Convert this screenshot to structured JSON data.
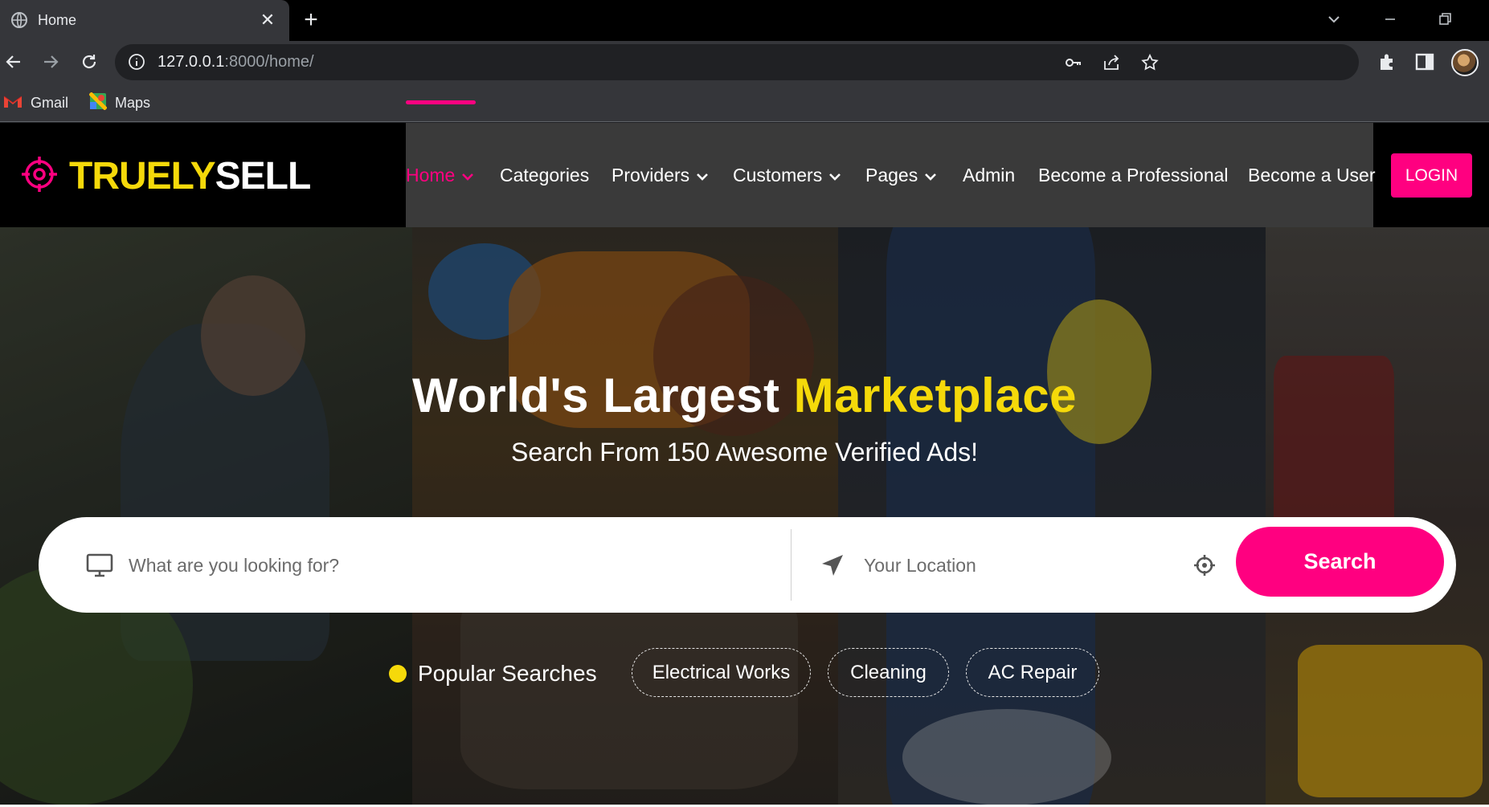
{
  "browser": {
    "tab_title": "Home",
    "url_host": "127.0.0.1",
    "url_path": ":8000/home/",
    "bookmarks": [
      "Gmail",
      "Maps"
    ]
  },
  "site": {
    "brand_part1": "TRUELY",
    "brand_part2": "SELL",
    "nav": {
      "home": "Home",
      "categories": "Categories",
      "providers": "Providers",
      "customers": "Customers",
      "pages": "Pages",
      "admin": "Admin",
      "become_professional": "Become a Professional",
      "become_user": "Become a User"
    },
    "login_label": "LOGIN",
    "colors": {
      "accent": "#ff0080",
      "highlight": "#f5d90a",
      "header_bg": "#000000",
      "menu_bg": "#3a3a3a"
    }
  },
  "hero": {
    "title_part1": "World's Largest",
    "title_highlight": "Marketplace",
    "subtitle": "Search From 150 Awesome Verified Ads!",
    "search": {
      "keyword_placeholder": "What are you looking for?",
      "location_placeholder": "Your Location",
      "button_label": "Search"
    },
    "popular_label": "Popular Searches",
    "popular_tags": [
      "Electrical Works",
      "Cleaning",
      "AC Repair"
    ]
  },
  "icons": {
    "tab": "globe-icon",
    "search_keyword": "monitor-icon",
    "search_location": "location-arrow-icon",
    "detect_location": "crosshair-icon",
    "logo": "target-icon"
  }
}
